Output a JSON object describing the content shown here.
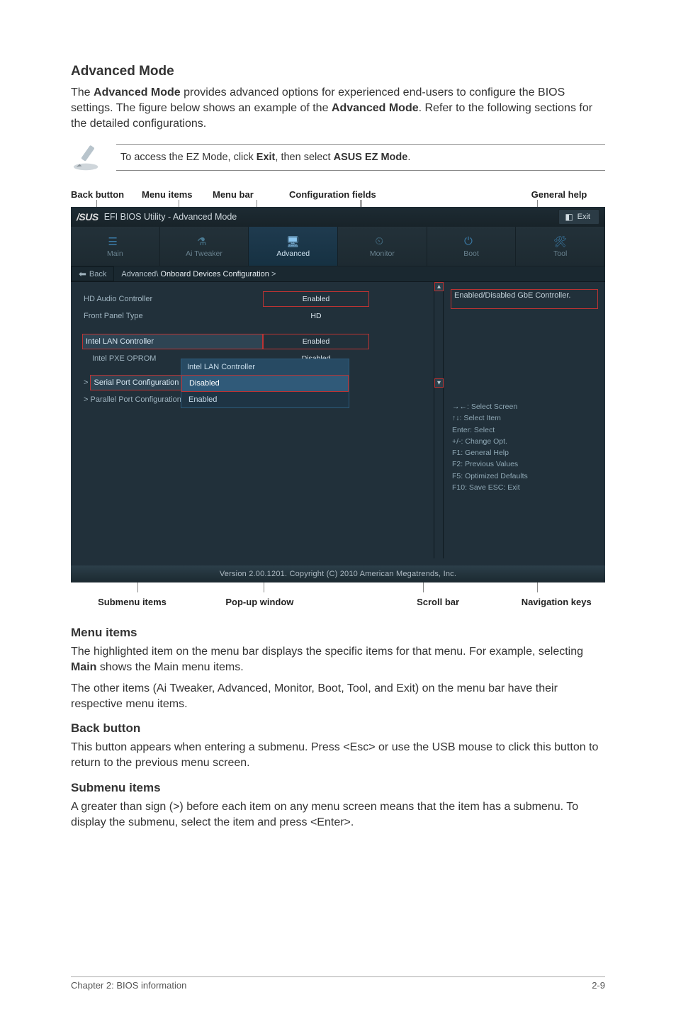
{
  "headings": {
    "advanced_mode": "Advanced Mode",
    "menu_items": "Menu items",
    "back_button": "Back button",
    "submenu_items": "Submenu items"
  },
  "paragraphs": {
    "adv_intro_pre": "The ",
    "adv_intro_bold1": "Advanced Mode",
    "adv_intro_mid": " provides advanced options for experienced end-users to configure the BIOS settings. The figure below shows an example of the ",
    "adv_intro_bold2": "Advanced Mode",
    "adv_intro_post": ". Refer to the following sections for the detailed configurations.",
    "menu_items_p1_pre": "The highlighted item on the menu bar displays the specific items for that menu. For example, selecting ",
    "menu_items_p1_bold": "Main",
    "menu_items_p1_post": " shows the Main menu items.",
    "menu_items_p2": "The other items (Ai Tweaker, Advanced, Monitor, Boot, Tool, and Exit) on the menu bar have their respective menu items.",
    "back_button_p": "This button appears when entering a submenu. Press <Esc> or use the USB mouse to click this button to return to the previous menu screen.",
    "submenu_items_p": "A greater than sign (>) before each item on any menu screen means that the item has a submenu. To display the submenu, select the item and press <Enter>."
  },
  "tip": {
    "pre": "To access the EZ Mode, click ",
    "bold1": "Exit",
    "mid": ", then select ",
    "bold2": "ASUS EZ Mode",
    "post": "."
  },
  "annot_top": {
    "back_button": "Back button",
    "menu_items": "Menu items",
    "menu_bar": "Menu bar",
    "config_fields": "Configuration fields",
    "general_help": "General help"
  },
  "annot_bottom": {
    "submenu_items": "Submenu items",
    "popup_window": "Pop-up window",
    "scroll_bar": "Scroll bar",
    "nav_keys": "Navigation keys"
  },
  "bios": {
    "brand": "/SUS",
    "title": "EFI BIOS Utility - Advanced Mode",
    "exit": "Exit",
    "tabs": {
      "main": "Main",
      "ai_tweaker": "Ai  Tweaker",
      "advanced": "Advanced",
      "monitor": "Monitor",
      "boot": "Boot",
      "tool": "Tool"
    },
    "back": "Back",
    "breadcrumb_pre": "Advanced\\ ",
    "breadcrumb_cur": "Onboard Devices Configuration",
    "breadcrumb_suf": " >",
    "rows": {
      "hd_audio": "HD Audio Controller",
      "front_panel": "Front Panel Type",
      "intel_lan": "Intel LAN Controller",
      "intel_pxe": "Intel PXE OPROM",
      "serial": "Serial Port Configuration",
      "parallel": "Parallel Port Configuration"
    },
    "field_values": {
      "hd_audio": "Enabled",
      "front_panel": "HD",
      "intel_lan": "Enabled",
      "intel_pxe": "Disabled"
    },
    "popup": {
      "title": "Intel LAN Controller",
      "opt_disabled": "Disabled",
      "opt_enabled": "Enabled"
    },
    "help_text": "Enabled/Disabled GbE Controller.",
    "navkeys": {
      "l1": "→←:  Select Screen",
      "l2": "↑↓:  Select Item",
      "l3": "Enter:  Select",
      "l4": "+/-:  Change Opt.",
      "l5": "F1:  General Help",
      "l6": "F2:  Previous Values",
      "l7": "F5:  Optimized Defaults",
      "l8": "F10:  Save   ESC: Exit"
    },
    "version": "Version 2.00.1201.  Copyright (C) 2010 American Megatrends, Inc."
  },
  "footer": {
    "chapter": "Chapter 2: BIOS information",
    "page": "2-9"
  }
}
